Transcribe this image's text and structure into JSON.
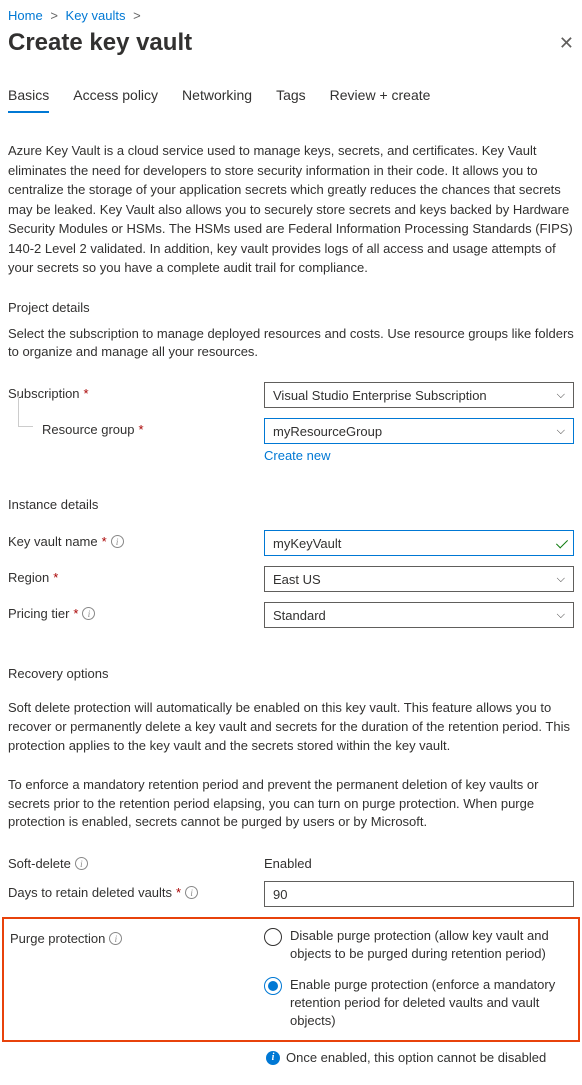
{
  "breadcrumb": {
    "home": "Home",
    "keyvaults": "Key vaults"
  },
  "title": "Create key vault",
  "tabs": [
    "Basics",
    "Access policy",
    "Networking",
    "Tags",
    "Review + create"
  ],
  "description": "Azure Key Vault is a cloud service used to manage keys, secrets, and certificates. Key Vault eliminates the need for developers to store security information in their code. It allows you to centralize the storage of your application secrets which greatly reduces the chances that secrets may be leaked. Key Vault also allows you to securely store secrets and keys backed by Hardware Security Modules or HSMs. The HSMs used are Federal Information Processing Standards (FIPS) 140-2 Level 2 validated. In addition, key vault provides logs of all access and usage attempts of your secrets so you have a complete audit trail for compliance.",
  "projectDetails": {
    "heading": "Project details",
    "desc": "Select the subscription to manage deployed resources and costs. Use resource groups like folders to organize and manage all your resources.",
    "subscriptionLabel": "Subscription",
    "subscriptionValue": "Visual Studio Enterprise Subscription",
    "resourceGroupLabel": "Resource group",
    "resourceGroupValue": "myResourceGroup",
    "createNewLabel": "Create new"
  },
  "instanceDetails": {
    "heading": "Instance details",
    "nameLabel": "Key vault name",
    "nameValue": "myKeyVault",
    "regionLabel": "Region",
    "regionValue": "East US",
    "tierLabel": "Pricing tier",
    "tierValue": "Standard"
  },
  "recovery": {
    "heading": "Recovery options",
    "desc1": "Soft delete protection will automatically be enabled on this key vault. This feature allows you to recover or permanently delete a key vault and secrets for the duration of the retention period. This protection applies to the key vault and the secrets stored within the key vault.",
    "desc2": "To enforce a mandatory retention period and prevent the permanent deletion of key vaults or secrets prior to the retention period elapsing, you can turn on purge protection. When purge protection is enabled, secrets cannot be purged by users or by Microsoft.",
    "softDeleteLabel": "Soft-delete",
    "softDeleteValue": "Enabled",
    "retentionLabel": "Days to retain deleted vaults",
    "retentionValue": "90",
    "purgeLabel": "Purge protection",
    "purgeOption1": "Disable purge protection (allow key vault and objects to be purged during retention period)",
    "purgeOption2": "Enable purge protection (enforce a mandatory retention period for deleted vaults and vault objects)",
    "purgeNote": "Once enabled, this option cannot be disabled"
  }
}
